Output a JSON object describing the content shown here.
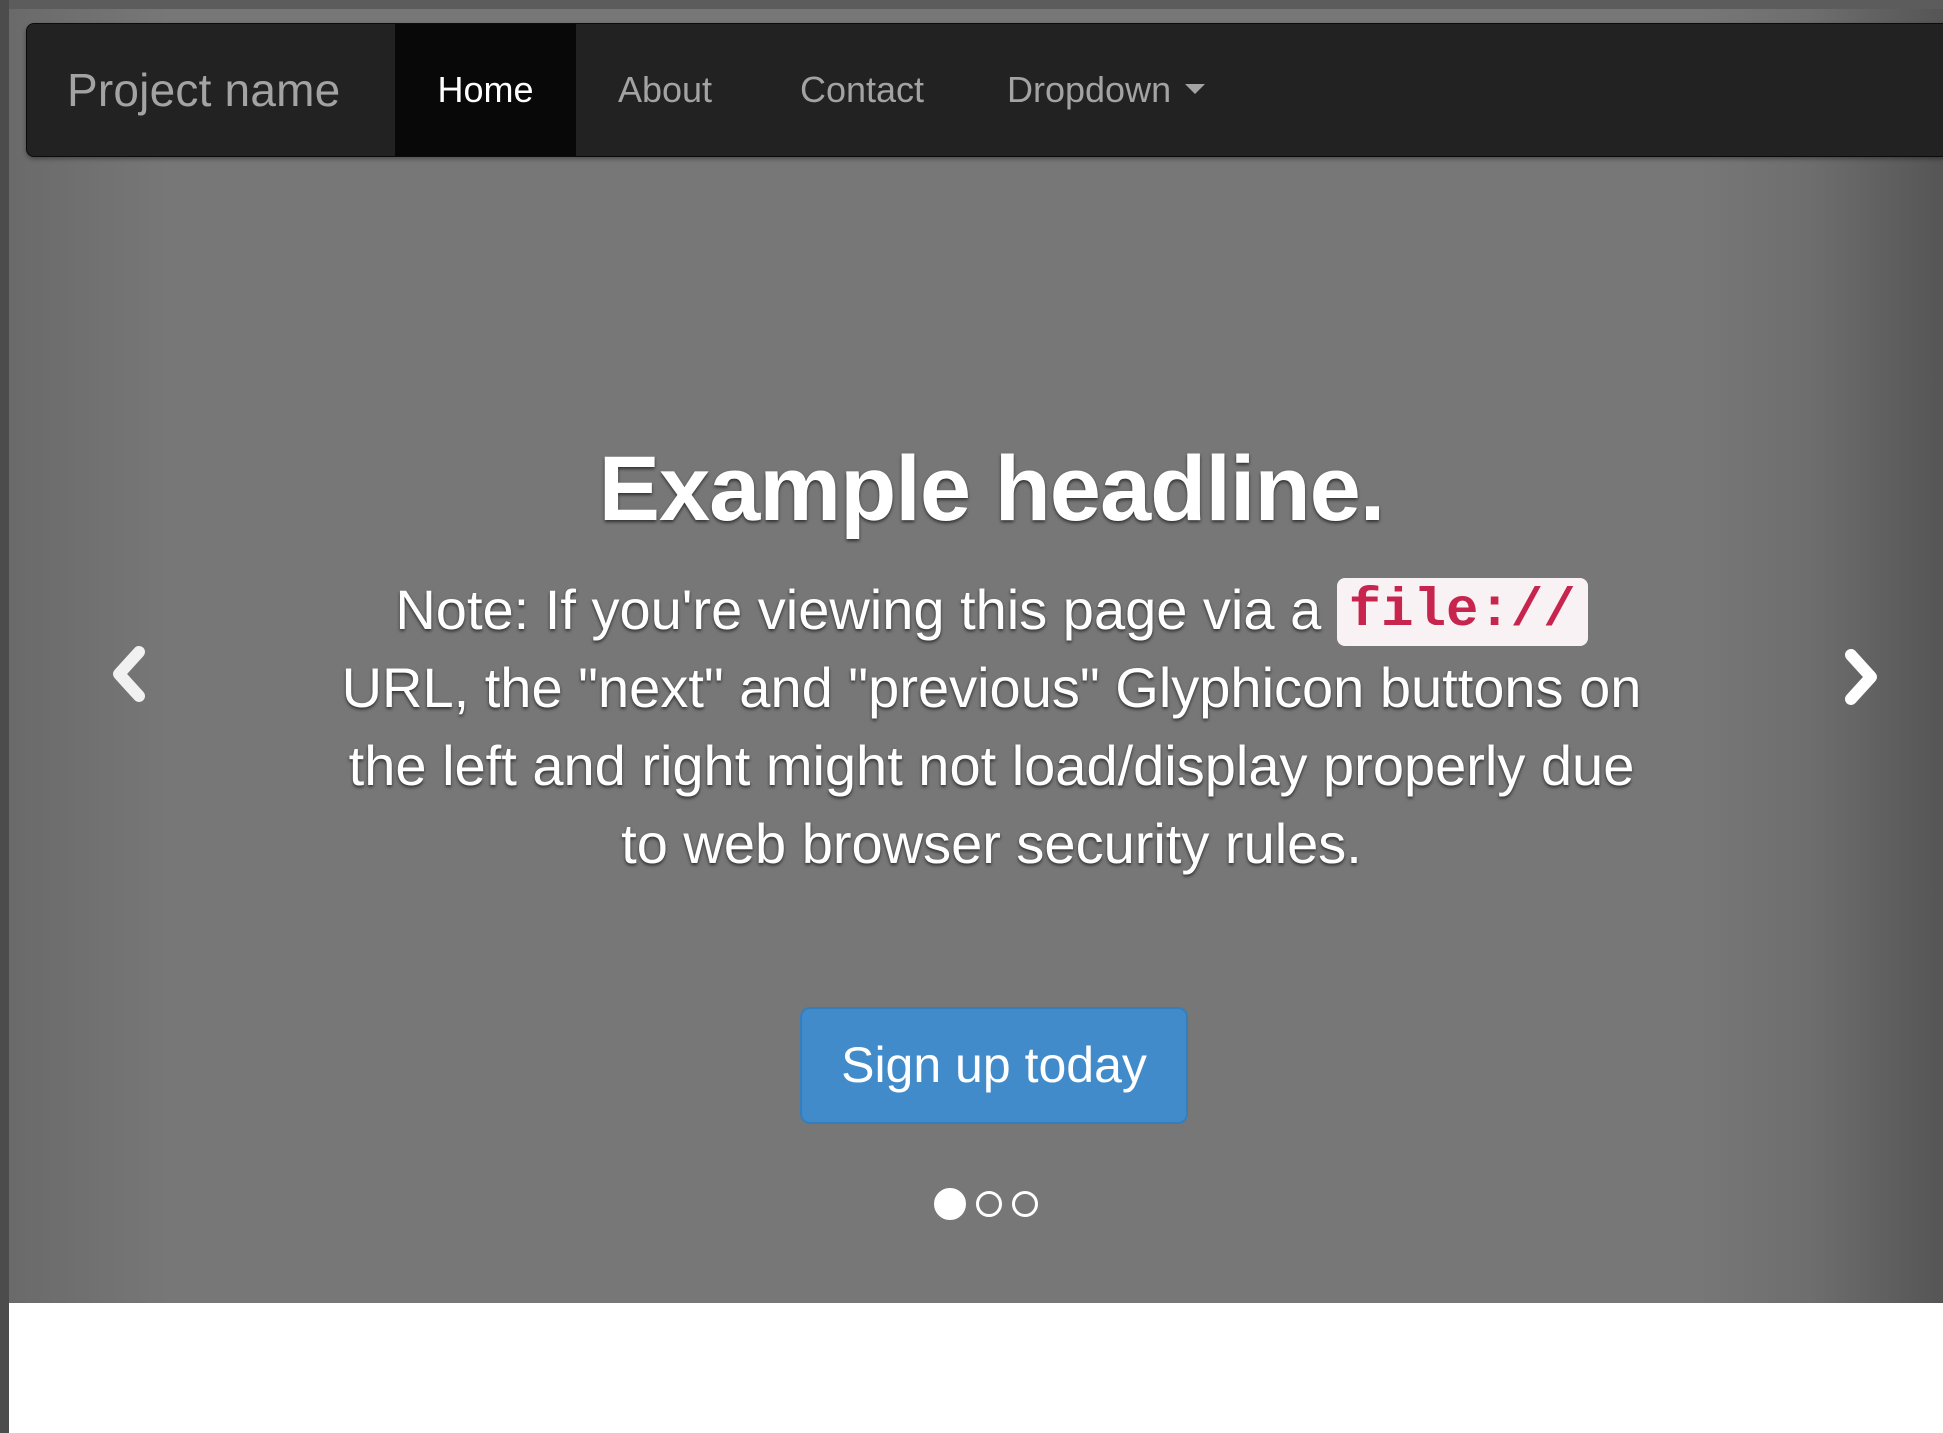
{
  "navbar": {
    "brand": "Project name",
    "items": [
      {
        "label": "Home",
        "active": true
      },
      {
        "label": "About",
        "active": false
      },
      {
        "label": "Contact",
        "active": false
      },
      {
        "label": "Dropdown",
        "active": false
      }
    ]
  },
  "carousel": {
    "headline": "Example headline.",
    "note_before": "Note: If you're viewing this page via a ",
    "note_code": "file://",
    "note_after": " URL, the \"next\" and \"previous\" Glyphicon buttons on the left and right might not load/display properly due to web browser security rules.",
    "cta_label": "Sign up today",
    "prev_icon": "chevron-left-icon",
    "next_icon": "chevron-right-icon",
    "slides": 3,
    "active_slide": 1
  },
  "colors": {
    "navbar_bg": "#222222",
    "nav_active_bg": "#080808",
    "carousel_bg": "#777777",
    "cta_bg": "#428bca",
    "code_color": "#c7254e",
    "code_bg": "#f9f2f4"
  }
}
